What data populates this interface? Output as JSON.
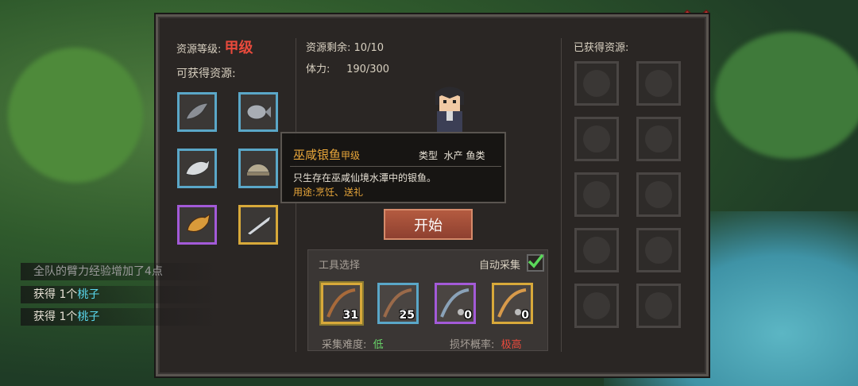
{
  "resource_grade_label": "资源等级:",
  "resource_grade_value": "甲级",
  "obtainable_title": "可获得资源:",
  "remaining_label": "资源剩余:",
  "remaining_value": "10/10",
  "stamina_label": "体力:",
  "stamina_value": "190/300",
  "obtained_title": "已获得资源:",
  "tooltip": {
    "name": "巫咸银鱼",
    "grade": "甲级",
    "type_label": "类型",
    "type_value": "水产 鱼类",
    "description": "只生存在巫咸仙境水潭中的银鱼。",
    "usage_label": "用途:",
    "usage_value": "烹饪、送礼"
  },
  "start_button": "开始",
  "tools": {
    "title": "工具选择",
    "auto_label": "自动采集",
    "auto_checked": true,
    "items": [
      {
        "count": "31",
        "rarity": "gold",
        "selected": true
      },
      {
        "count": "25",
        "rarity": "blue",
        "selected": false
      },
      {
        "count": "0",
        "rarity": "purple",
        "selected": false
      },
      {
        "count": "0",
        "rarity": "gold",
        "selected": false
      }
    ],
    "difficulty_label": "采集难度:",
    "difficulty_value": "低",
    "break_label": "损坏概率:",
    "break_value": "极高"
  },
  "resources": [
    {
      "icon": "gray-fish-icon",
      "rarity": "blue"
    },
    {
      "icon": "silver-fish-icon",
      "rarity": "blue"
    },
    {
      "icon": "white-fish-icon",
      "rarity": "blue"
    },
    {
      "icon": "clam-icon",
      "rarity": "blue"
    },
    {
      "icon": "golden-carp-icon",
      "rarity": "purple"
    },
    {
      "icon": "silver-swordfish-icon",
      "rarity": "gold"
    }
  ],
  "log": [
    {
      "prefix": "全队的臂力经验增加了4点",
      "item": ""
    },
    {
      "prefix": "获得 1个",
      "item": "桃子"
    },
    {
      "prefix": "获得 1个",
      "item": "桃子"
    }
  ],
  "colors": {
    "accent_red": "#e84a3c",
    "cyan": "#5ad8ee",
    "difficulty_green": "#6ad86a"
  }
}
